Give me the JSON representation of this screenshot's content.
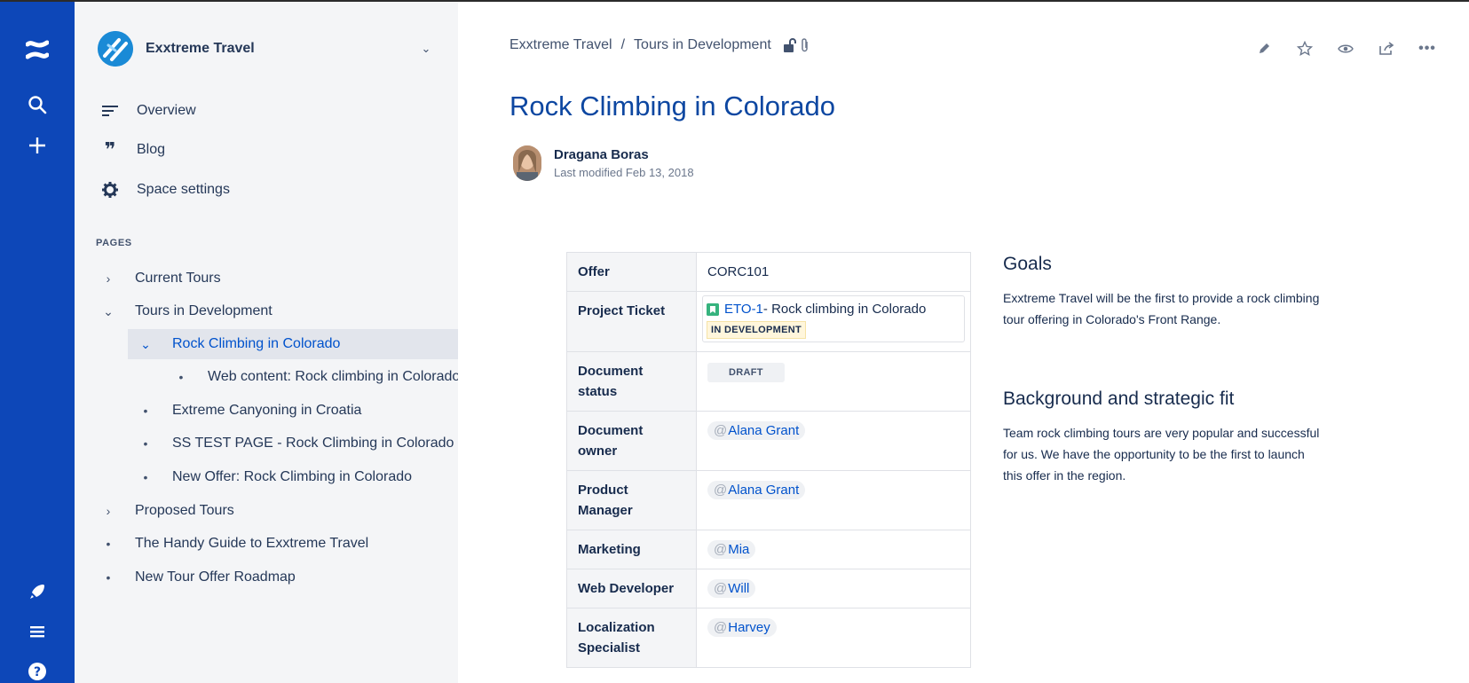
{
  "space": {
    "name": "Exxtreme Travel"
  },
  "sidebar": {
    "nav": [
      {
        "label": "Overview",
        "icon": "overview-icon"
      },
      {
        "label": "Blog",
        "icon": "quote-icon"
      },
      {
        "label": "Space settings",
        "icon": "gear-icon"
      }
    ],
    "pages_heading": "PAGES",
    "tree": [
      {
        "label": "Current Tours",
        "twisty": "›"
      },
      {
        "label": "Tours in Development",
        "twisty": "⌄"
      },
      {
        "label": "Rock Climbing in Colorado",
        "twisty": "⌄",
        "active": true
      },
      {
        "label": "Web content: Rock climbing in Colorado",
        "twisty": "•"
      },
      {
        "label": "Extreme Canyoning in Croatia",
        "twisty": "•"
      },
      {
        "label": "SS TEST PAGE - Rock Climbing in Colorado",
        "twisty": "•"
      },
      {
        "label": "New Offer: Rock Climbing in Colorado",
        "twisty": "•"
      },
      {
        "label": "Proposed Tours",
        "twisty": "›"
      },
      {
        "label": "The Handy Guide to Exxtreme Travel",
        "twisty": "•"
      },
      {
        "label": "New Tour Offer Roadmap",
        "twisty": "•"
      }
    ]
  },
  "breadcrumb": {
    "items": [
      "Exxtreme Travel",
      "Tours in Development"
    ],
    "separator": "/"
  },
  "page": {
    "title": "Rock Climbing in Colorado",
    "author": "Dragana Boras",
    "modified": "Last modified Feb 13, 2018"
  },
  "table": {
    "offer_label": "Offer",
    "offer_value": "CORC101",
    "ticket_label": "Project Ticket",
    "ticket_key": "ETO-1",
    "ticket_summary": " - Rock climbing in Colorado",
    "ticket_status": "IN DEVELOPMENT",
    "doc_status_label": "Document status",
    "doc_status_value": "DRAFT",
    "doc_owner_label": "Document owner",
    "doc_owner_value": "Alana Grant",
    "pm_label": "Product Manager",
    "pm_value": "Alana Grant",
    "marketing_label": "Marketing",
    "marketing_value": "Mia",
    "webdev_label": "Web Developer",
    "webdev_value": "Will",
    "l10n_label": "Localization Specialist",
    "l10n_value": "Harvey",
    "mention_prefix": "@"
  },
  "goals": {
    "heading": "Goals",
    "text": "Exxtreme Travel will be the first to provide a rock climbing tour offering in Colorado's Front Range."
  },
  "background": {
    "heading": "Background and strategic fit",
    "text": "Team rock climbing tours are very popular and successful for us. We have the opportunity to be the first to launch this offer in the region."
  },
  "colors": {
    "global_nav": "#0d47b8",
    "sidebar": "#f4f5f7",
    "title": "#0d47a1",
    "link": "#0052cc"
  }
}
